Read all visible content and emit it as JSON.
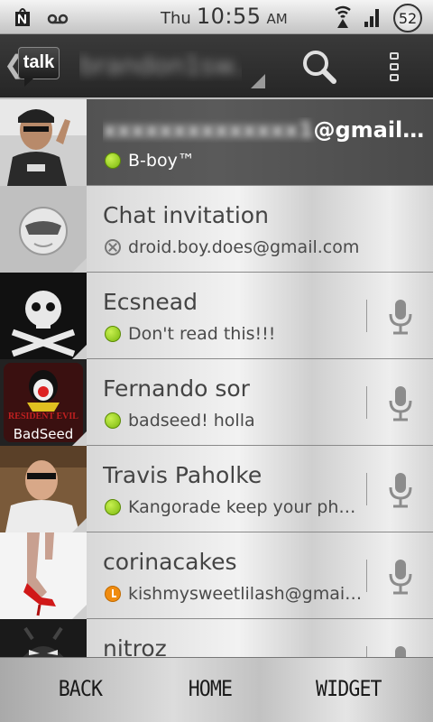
{
  "status_bar": {
    "day": "Thu",
    "time": "10:55",
    "ampm": "AM",
    "battery_level": "52",
    "icons": [
      "notification-icon",
      "voicemail-icon",
      "wifi-icon",
      "signal-icon",
      "battery-icon"
    ]
  },
  "action_bar": {
    "app_logo": "talk",
    "account_name": "brandon1sw...",
    "icons": [
      "back-chevron-icon",
      "search-icon",
      "overflow-menu-icon"
    ]
  },
  "self": {
    "email_hidden": "xxxxxxxxxxxxxx1",
    "email_suffix": "@gmail.com",
    "status_text": "B-boy™",
    "presence": "available"
  },
  "contacts": [
    {
      "name": "Chat invitation",
      "status": "droid.boy.does@gmail.com",
      "presence": "invite",
      "has_mic": false
    },
    {
      "name": " Ecsnead",
      "status": "Don't read this!!!",
      "presence": "available",
      "has_mic": true
    },
    {
      "name": "Fernando sor",
      "status": "badseed! holla",
      "presence": "available",
      "has_mic": true,
      "avatar_label": "BadSeed",
      "avatar_sub": "RESIDENT EVIL"
    },
    {
      "name": "Travis Paholke",
      "status": "Kangorade keep your phon..",
      "presence": "available",
      "has_mic": true
    },
    {
      "name": "corinacakes",
      "status": "kishmysweetlilash@gmail....",
      "presence": "idle",
      "has_mic": true
    },
    {
      "name": "nitroz",
      "status": "",
      "presence": "available",
      "has_mic": true
    }
  ],
  "nav_bar": {
    "back_label": "BACK",
    "home_label": "HOME",
    "widget_label": "WIDGET"
  },
  "colors": {
    "available": "#8cc618",
    "idle": "#f08c10",
    "self_row": "#4d4d4d",
    "action_bar": "#2a2a2a"
  }
}
